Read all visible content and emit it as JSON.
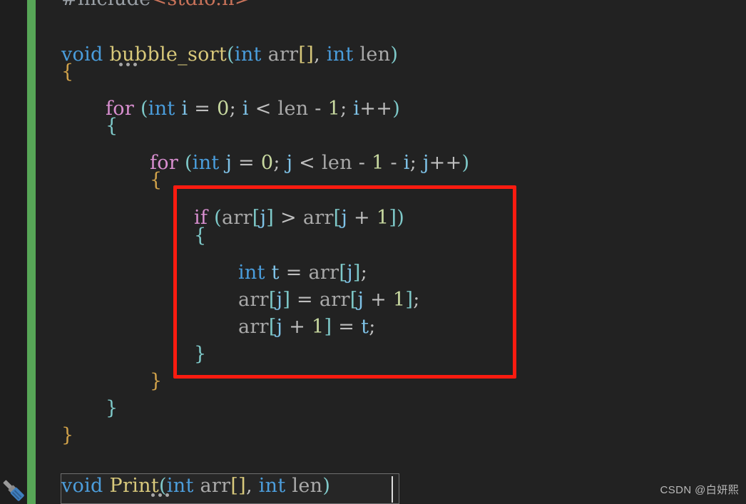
{
  "editor": {
    "background_color": "#222222",
    "margin_color": "#1e1e1e",
    "change_bar_color": "#57a657",
    "annotation_color": "#fc1b10"
  },
  "code": {
    "line0": {
      "preprocessor": "#include",
      "header": "<stdio.h>"
    },
    "line1": {
      "kw_void": "void",
      "fn_name": "bubble_sort",
      "paren_open": "(",
      "type_int_1": "int",
      "param_arr": "arr",
      "brackets": "[]",
      "comma": ", ",
      "type_int_2": "int",
      "param_len": "len",
      "paren_close": ")"
    },
    "line2": {
      "brace": "{"
    },
    "line3": {
      "kw_for": "for",
      "paren_open": "(",
      "type_int": "int",
      "var_i": "i",
      "assign": " = ",
      "zero": "0",
      "semi1": "; ",
      "var_i2": "i",
      "lt": " < ",
      "len": "len",
      "minus": " - ",
      "one": "1",
      "semi2": "; ",
      "var_i3": "i",
      "inc": "++",
      "paren_close": ")"
    },
    "line4": {
      "brace": "{"
    },
    "line5": {
      "kw_for": "for",
      "paren_open": "(",
      "type_int": "int",
      "var_j": "j",
      "assign": " = ",
      "zero": "0",
      "semi1": "; ",
      "var_j2": "j",
      "lt": " < ",
      "len": "len",
      "minus1": " - ",
      "one": "1",
      "minus2": " - ",
      "var_i": "i",
      "semi2": "; ",
      "var_j3": "j",
      "inc": "++",
      "paren_close": ")"
    },
    "line6": {
      "brace": "{"
    },
    "line7": {
      "kw_if": "if",
      "paren_open": "(",
      "arr1": "arr",
      "lb1": "[",
      "var_j1": "j",
      "rb1": "]",
      "gt": " > ",
      "arr2": "arr",
      "lb2": "[",
      "var_j2": "j",
      "plus": " + ",
      "one": "1",
      "rb2": "]",
      "paren_close": ")"
    },
    "line8": {
      "brace": "{"
    },
    "line9": {
      "type_int": "int",
      "var_t": "t",
      "assign": " = ",
      "arr": "arr",
      "lb": "[",
      "var_j": "j",
      "rb": "]",
      "semi": ";"
    },
    "line10": {
      "arr1": "arr",
      "lb1": "[",
      "var_j1": "j",
      "rb1": "]",
      "assign": " = ",
      "arr2": "arr",
      "lb2": "[",
      "var_j2": "j",
      "plus": " + ",
      "one": "1",
      "rb2": "]",
      "semi": ";"
    },
    "line11": {
      "arr": "arr",
      "lb": "[",
      "var_j": "j",
      "plus": " + ",
      "one": "1",
      "rb": "]",
      "assign": " = ",
      "var_t": "t",
      "semi": ";"
    },
    "line12": {
      "brace": "}"
    },
    "line13": {
      "brace": "}"
    },
    "line14": {
      "brace": "}"
    },
    "line15": {
      "brace": "}"
    },
    "line16": {
      "kw_void": "void",
      "fn_name": "Print",
      "paren_open": "(",
      "type_int_1": "int",
      "param_arr": "arr",
      "brackets": "[]",
      "comma": ", ",
      "type_int_2": "int",
      "param_len": "len",
      "paren_close": ")"
    }
  },
  "icons": {
    "fold_chevron": "chevron-down-icon",
    "quick_actions": "three-dots-icon",
    "tool": "screwdriver-icon"
  },
  "watermark": {
    "text": "CSDN @白妍熙"
  }
}
